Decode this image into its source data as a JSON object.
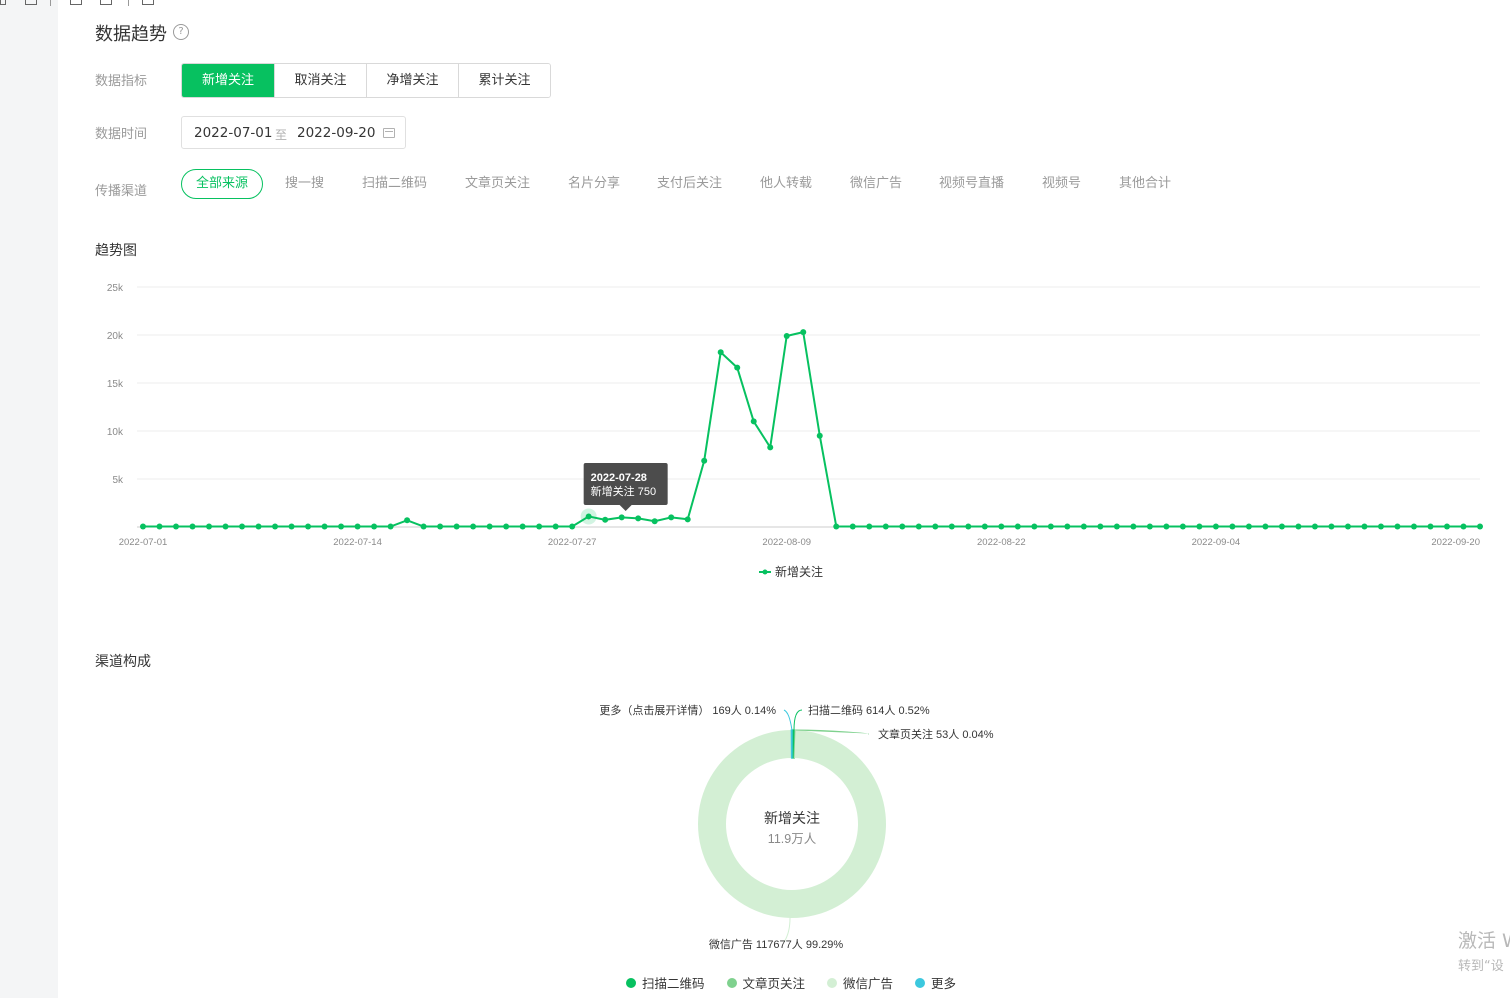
{
  "header": {
    "title": "数据趋势",
    "help_icon": "question-circle-icon"
  },
  "metric": {
    "label": "数据指标",
    "tabs": [
      "新增关注",
      "取消关注",
      "净增关注",
      "累计关注"
    ],
    "active_tab": "新增关注"
  },
  "time": {
    "label": "数据时间",
    "start": "2022-07-01",
    "separator": "至",
    "end": "2022-09-20",
    "icon": "calendar-icon"
  },
  "channel": {
    "label": "传播渠道",
    "options": [
      "全部来源",
      "搜一搜",
      "扫描二维码",
      "文章页关注",
      "名片分享",
      "支付后关注",
      "他人转载",
      "微信广告",
      "视频号直播",
      "视频号",
      "其他合计"
    ],
    "active": "全部来源"
  },
  "trend": {
    "section_title": "趋势图",
    "tooltip": {
      "date": "2022-07-28",
      "text": "新增关注 750"
    },
    "legend": "新增关注"
  },
  "composition": {
    "section_title": "渠道构成",
    "center_title": "新增关注",
    "center_value": "11.9万人",
    "labels": {
      "more": "更多（点击展开详情） 169人 0.14%",
      "qrcode": "扫描二维码 614人 0.52%",
      "article": "文章页关注 53人 0.04%",
      "ad": "微信广告 117677人 99.29%"
    },
    "legend": [
      "扫描二维码",
      "文章页关注",
      "微信广告",
      "更多"
    ]
  },
  "watermark": {
    "line1": "激活 W",
    "line2": "转到“设"
  },
  "colors": {
    "accent": "#07c160",
    "qrcode": "#07c160",
    "article": "#7fd18e",
    "ad": "#d3efd4",
    "more": "#3cc8de"
  },
  "chart_data": [
    {
      "type": "line",
      "title": "趋势图",
      "x_tick_labels": [
        "2022-07-01",
        "2022-07-14",
        "2022-07-27",
        "2022-08-09",
        "2022-08-22",
        "2022-09-04",
        "2022-09-20"
      ],
      "y_tick_labels": [
        "5k",
        "10k",
        "15k",
        "20k",
        "25k"
      ],
      "ylim": [
        0,
        25000
      ],
      "grid": true,
      "legend_position": "bottom",
      "x_start": "2022-07-01",
      "x_end": "2022-09-20",
      "series": [
        {
          "name": "新增关注",
          "values": [
            50,
            50,
            50,
            50,
            50,
            50,
            50,
            50,
            50,
            50,
            50,
            50,
            50,
            50,
            50,
            50,
            700,
            50,
            50,
            50,
            50,
            50,
            50,
            50,
            50,
            50,
            50,
            1100,
            750,
            1000,
            900,
            600,
            1000,
            800,
            6900,
            18200,
            16600,
            11000,
            8300,
            19900,
            20300,
            9500,
            50,
            50,
            50,
            50,
            50,
            50,
            50,
            50,
            50,
            50,
            50,
            50,
            50,
            50,
            50,
            50,
            50,
            50,
            50,
            50,
            50,
            50,
            50,
            50,
            50,
            50,
            50,
            50,
            50,
            50,
            50,
            50,
            50,
            50,
            50,
            50,
            50,
            50,
            50,
            50
          ]
        }
      ]
    },
    {
      "type": "pie",
      "title": "渠道构成",
      "center_label": "新增关注 11.9万人",
      "categories": [
        "扫描二维码",
        "文章页关注",
        "微信广告",
        "更多"
      ],
      "values": [
        614,
        53,
        117677,
        169
      ],
      "percentages": [
        0.52,
        0.04,
        99.29,
        0.14
      ],
      "legend_position": "bottom"
    }
  ]
}
